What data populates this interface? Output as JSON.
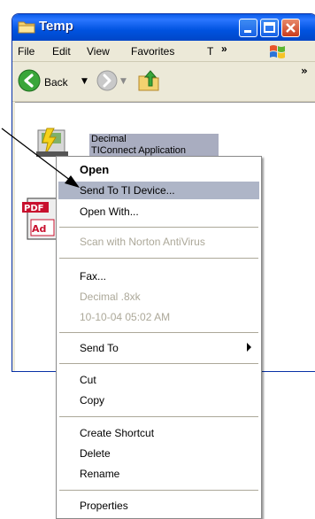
{
  "window": {
    "title": "Temp",
    "menu": [
      "File",
      "Edit",
      "View",
      "Favorites",
      "T",
      "»"
    ],
    "toolbar": {
      "back_label": "Back",
      "overflow": "»"
    }
  },
  "file": {
    "name_line1": "Decimal",
    "name_line2": "TIConnect Application"
  },
  "context_menu": {
    "items": [
      {
        "label": "Open",
        "bold": true
      },
      {
        "label": "Send To TI Device...",
        "highlighted": true
      },
      {
        "label": "Open With..."
      },
      {
        "label": "Scan with Norton AntiVirus",
        "disabled": true
      },
      {
        "label": "Fax..."
      },
      {
        "label": "Decimal .8xk",
        "disabled": true
      },
      {
        "label": "10-10-04 05:02 AM",
        "disabled": true
      },
      {
        "label": "Send To",
        "submenu": true
      },
      {
        "label": "Cut"
      },
      {
        "label": "Copy"
      },
      {
        "label": "Create Shortcut"
      },
      {
        "label": "Delete"
      },
      {
        "label": "Rename"
      },
      {
        "label": "Properties"
      }
    ]
  },
  "icons": {
    "folder": "folder-icon",
    "back": "back-arrow-icon",
    "forward": "forward-arrow-icon",
    "up": "up-folder-icon",
    "pdf": "pdf-file-icon",
    "file": "ti-file-icon",
    "windows": "windows-logo-icon"
  },
  "colors": {
    "titlebar": "#0053e0",
    "menu_highlight": "#aeb5c7",
    "disabled_text": "#aca899"
  }
}
